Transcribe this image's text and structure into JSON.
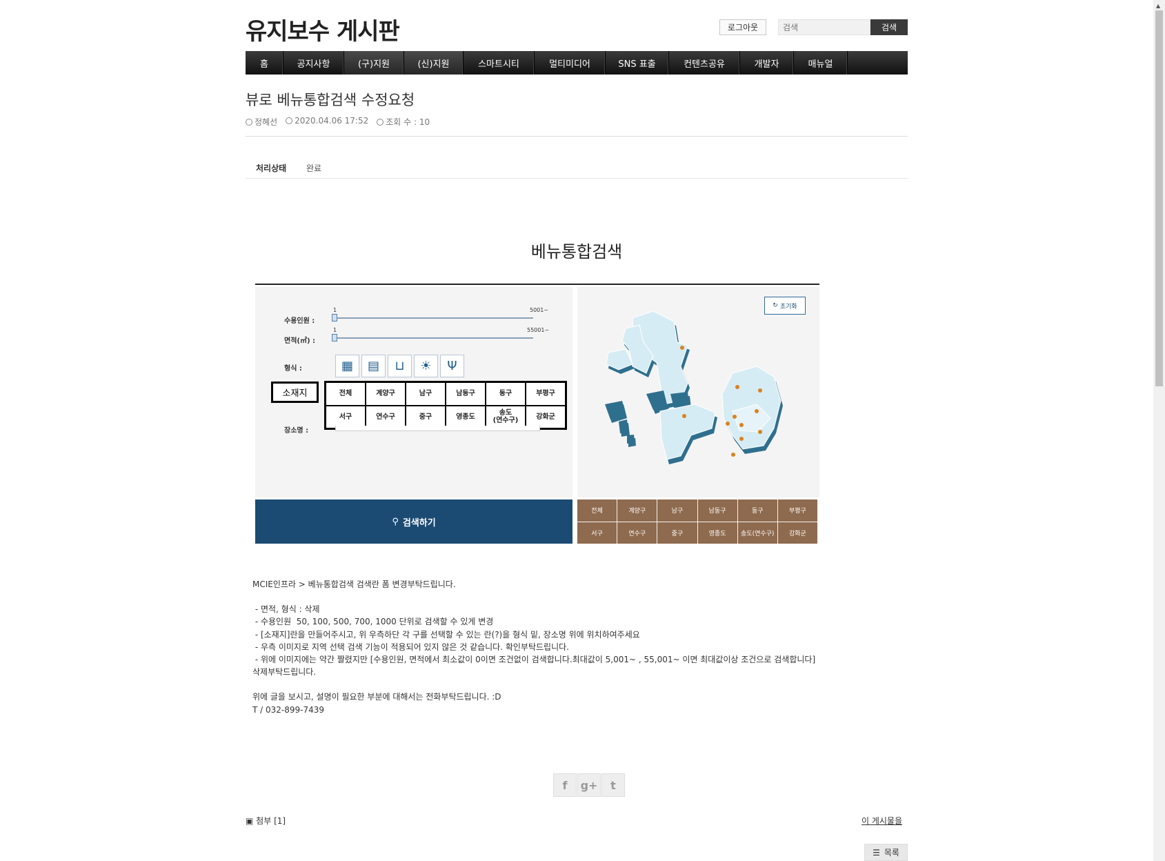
{
  "header": {
    "site_title": "유지보수 게시판",
    "logout_label": "로그아웃",
    "search_placeholder": "검색",
    "search_button": "검색"
  },
  "nav": [
    {
      "label": "홈",
      "active": false
    },
    {
      "label": "공지사항",
      "active": false
    },
    {
      "label": "(구)지원",
      "active": true
    },
    {
      "label": "(신)지원",
      "active": true
    },
    {
      "label": "스마트시티",
      "active": false
    },
    {
      "label": "멀티미디어",
      "active": false
    },
    {
      "label": "SNS 표출",
      "active": false
    },
    {
      "label": "컨텐츠공유",
      "active": false
    },
    {
      "label": "개발자",
      "active": false
    },
    {
      "label": "매뉴얼",
      "active": false
    }
  ],
  "post": {
    "title": "뷰로 베뉴통합검색 수정요청",
    "author": "정혜선",
    "datetime": "2020.04.06 17:52",
    "views": "조회 수 : 10",
    "status_label": "처리상태",
    "status_value": "완료"
  },
  "embedded_image": {
    "title": "베뉴통합검색",
    "capacity_label": "수용인원 :",
    "area_label": "면적(㎡) :",
    "type_label": "형식 :",
    "location_label": "소재지",
    "place_label": "장소명 :",
    "slider1_min": "1",
    "slider1_max": "5001~",
    "slider2_min": "1",
    "slider2_max": "55001~",
    "search_button": "검색하기",
    "reset_button": "초기화",
    "locations": [
      "전체",
      "계양구",
      "남구",
      "남동구",
      "동구",
      "부평구",
      "서구",
      "연수구",
      "중구",
      "영종도",
      "송도\n(연수구)",
      "강화군"
    ],
    "districts": [
      "전체",
      "계양구",
      "남구",
      "남동구",
      "동구",
      "부평구",
      "서구",
      "연수구",
      "중구",
      "영종도",
      "송도(연수구)",
      "강화군"
    ]
  },
  "body_lines": [
    "MCIE인프라 > 베뉴통합검색 검색란 폼 변경부탁드립니다.",
    "",
    " - 면적, 형식 : 삭제",
    " - 수용인원  50, 100, 500, 700, 1000 단위로 검색할 수 있게 변경",
    " - [소재지]란을 만들어주시고, 위 우측하단 각 구를 선택할 수 있는 란(?)을 형식 밑, 장소명 위에 위치하여주세요",
    " - 우측 이미지로 지역 선택 검색 기능이 적용되어 있지 않은 것 같습니다. 확인부탁드립니다.",
    " - 위에 이미지에는 약간 짤렸지만 [수용인원, 면적에서 최소값이 0이면 조건없이 검색합니다.최대값이 5,001~ , 55,001~ 이면 최대값이상 조건으로 검색합니다]",
    "삭제부탁드립니다.",
    "",
    "위에 글을 보시고, 설명이 필요한 부분에 대해서는 전화부탁드립니다. :D",
    "T / 032-899-7439"
  ],
  "footer": {
    "attach_label": "첨부 [1]",
    "report_link": "이 게시물을",
    "list_button": "목록"
  },
  "colors": {
    "nav_bg": "#1a1a1a",
    "search_btn_bg": "#1b4a73",
    "district_bg": "#8e6a4e",
    "map_fill": "#d6ecf4",
    "map_side": "#2f6f8e"
  }
}
